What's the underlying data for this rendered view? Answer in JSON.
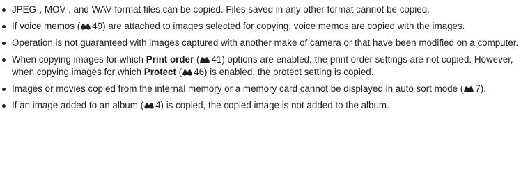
{
  "bullets": [
    {
      "text": "JPEG-, MOV-, and WAV-format files can be copied. Files saved in any other format cannot be copied."
    },
    {
      "before": "If voice memos (",
      "ref": "49",
      "after": ") are attached to images selected for copying, voice memos are copied with the images."
    },
    {
      "text": "Operation is not guaranteed with images captured with another make of camera or that have been modified on a computer."
    },
    {
      "p1": "When copying images for which ",
      "term1": "Print order",
      "p2": " (",
      "ref1": "41",
      "p3": ") options are enabled, the print order settings are not copied. However, when copying images for which ",
      "term2": "Protect",
      "p4": " (",
      "ref2": "46",
      "p5": ") is enabled, the protect setting is copied."
    },
    {
      "before": "Images or movies copied from the internal memory or a memory card cannot be displayed in auto sort mode (",
      "ref": "7",
      "after": ")."
    },
    {
      "before": "If an image added to an album (",
      "ref": "4",
      "after": ") is copied, the copied image is not added to the album."
    }
  ],
  "icons": {
    "reference": "binoculars-icon"
  }
}
